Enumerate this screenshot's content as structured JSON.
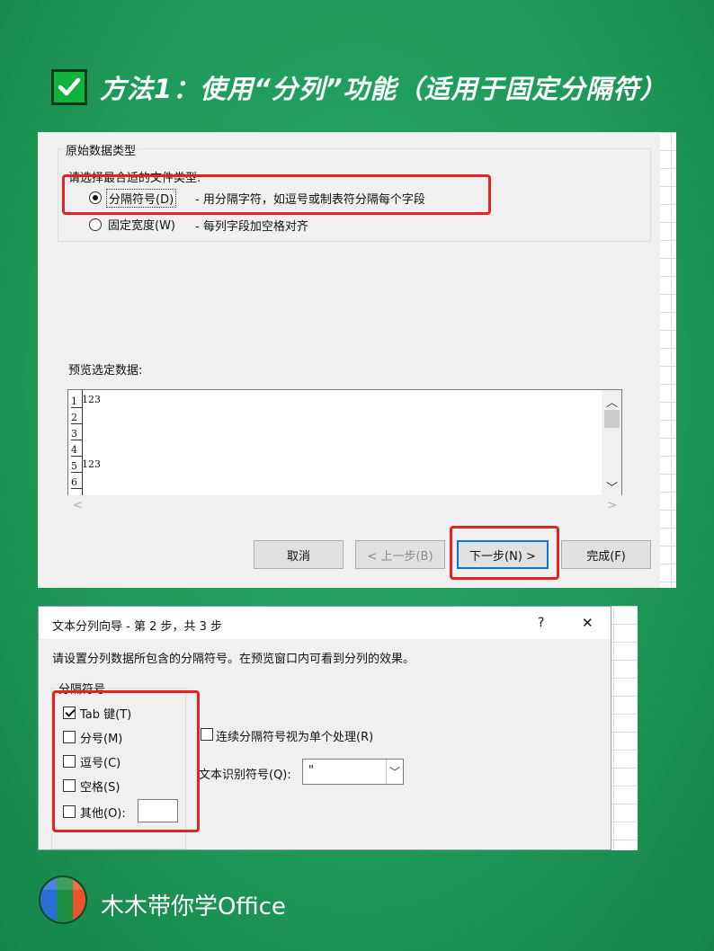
{
  "heading": {
    "text": "方法1：使用“分列”功能（适用于固定分隔符）"
  },
  "dialog1": {
    "group_title": "原始数据类型",
    "prompt": "请选择最合适的文件类型:",
    "options": [
      {
        "label": "分隔符号(D)",
        "desc": "- 用分隔字符，如逗号或制表符分隔每个字段",
        "selected": true
      },
      {
        "label": "固定宽度(W)",
        "desc": "- 每列字段加空格对齐",
        "selected": false
      }
    ],
    "preview_label": "预览选定数据:",
    "preview_rows": [
      {
        "num": "1",
        "text": "123"
      },
      {
        "num": "2",
        "text": ""
      },
      {
        "num": "3",
        "text": ""
      },
      {
        "num": "4",
        "text": ""
      },
      {
        "num": "5",
        "text": "123"
      },
      {
        "num": "6",
        "text": ""
      }
    ],
    "buttons": {
      "cancel": "取消",
      "back": "< 上一步(B)",
      "next": "下一步(N) >",
      "finish": "完成(F)"
    }
  },
  "dialog2": {
    "title": "文本分列向导 - 第 2 步，共 3 步",
    "help": "?",
    "close": "✕",
    "instruction": "请设置分列数据所包含的分隔符号。在预览窗口内可看到分列的效果。",
    "group_title": "分隔符号",
    "delimiters": [
      {
        "label": "Tab 键(T)",
        "checked": true
      },
      {
        "label": "分号(M)",
        "checked": false
      },
      {
        "label": "逗号(C)",
        "checked": false
      },
      {
        "label": "空格(S)",
        "checked": false
      },
      {
        "label": "其他(O):",
        "checked": false
      }
    ],
    "consecutive_label": "连续分隔符号视为单个处理(R)",
    "qualifier_label": "文本识别符号(Q):",
    "qualifier_value": "\""
  },
  "footer": {
    "brand": "木木带你学Office"
  },
  "colors": {
    "background": "#1f9a58",
    "highlight_red": "#e32222",
    "check_green": "#12b33c",
    "primary_blue": "#0078d7"
  }
}
